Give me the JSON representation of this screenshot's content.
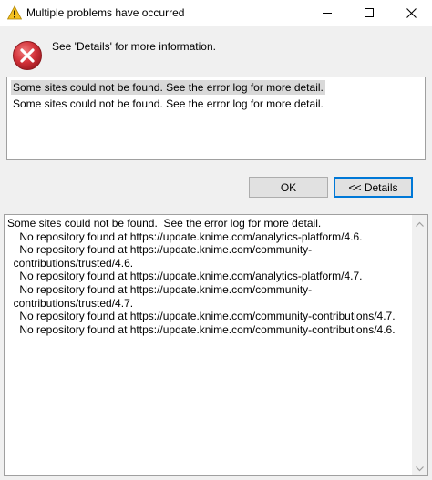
{
  "window": {
    "title": "Multiple problems have occurred"
  },
  "header": {
    "message": "See 'Details' for more information."
  },
  "problems": {
    "items": [
      "Some sites could not be found.  See the error log for more detail.",
      "Some sites could not be found.  See the error log for more detail."
    ],
    "selected_index": 0
  },
  "buttons": {
    "ok_label": "OK",
    "details_label": "<< Details"
  },
  "details": {
    "text": "Some sites could not be found.  See the error log for more detail.\n    No repository found at https://update.knime.com/analytics-platform/4.6.\n    No repository found at https://update.knime.com/community-\n  contributions/trusted/4.6.\n    No repository found at https://update.knime.com/analytics-platform/4.7.\n    No repository found at https://update.knime.com/community-\n  contributions/trusted/4.7.\n    No repository found at https://update.knime.com/community-contributions/4.7.\n    No repository found at https://update.knime.com/community-contributions/4.6."
  },
  "icons": {
    "title_icon": "warning-triangle-icon",
    "header_icon": "error-circle-icon"
  },
  "colors": {
    "error_red": "#d3323a",
    "warning_yellow": "#f4c020",
    "selection": "#d9d9d9",
    "default_button_border": "#0078d7"
  }
}
